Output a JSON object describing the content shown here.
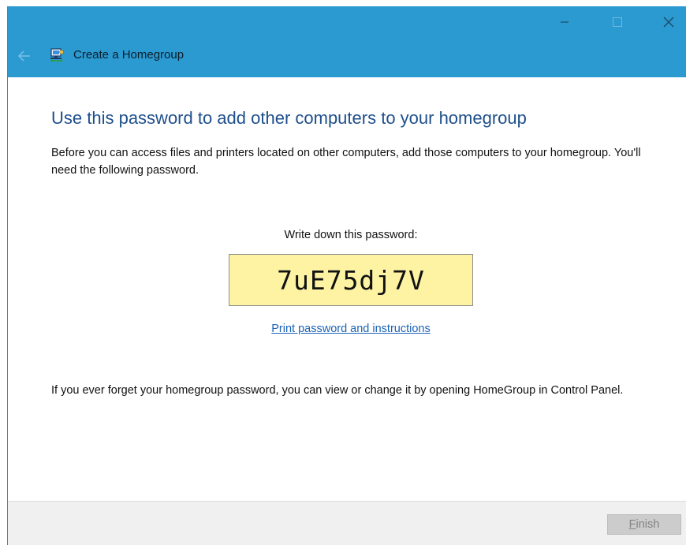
{
  "window": {
    "title": "Create a Homegroup",
    "controls": {
      "minimize": "minimize-icon",
      "maximize": "maximize-icon",
      "close": "close-icon"
    },
    "back_icon": "back-arrow-icon",
    "app_icon": "homegroup-icon"
  },
  "main": {
    "heading": "Use this password to add other computers to your homegroup",
    "intro": "Before you can access files and printers located on other computers, add those computers to your homegroup. You'll need the following password.",
    "password_label": "Write down this password:",
    "password": "7uE75dj7V",
    "print_link": "Print password and instructions",
    "footnote": "If you ever forget your homegroup password, you can view or change it by opening HomeGroup in Control Panel."
  },
  "footer": {
    "finish_accel": "F",
    "finish_rest": "inish"
  },
  "colors": {
    "titlebar": "#2b9ad1",
    "heading": "#1e4f8c",
    "link": "#1a63b6",
    "password_bg": "#fdf3a3",
    "footer_bg": "#f0f0f0"
  }
}
